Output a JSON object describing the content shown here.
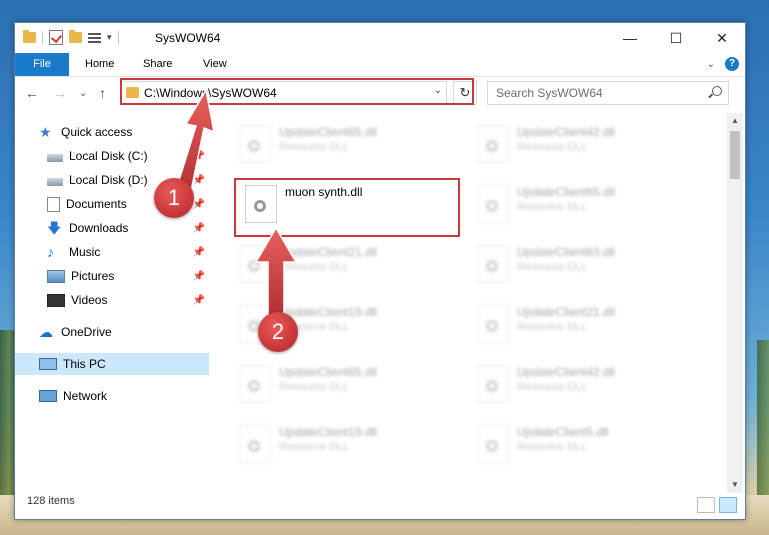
{
  "window": {
    "title": "SysWOW64"
  },
  "ribbon": {
    "tabs": [
      "File",
      "Home",
      "Share",
      "View"
    ]
  },
  "address": {
    "path": "C:\\Windows\\SysWOW64"
  },
  "search": {
    "placeholder": "Search SysWOW64"
  },
  "sidebar": {
    "items": [
      {
        "label": "Quick access",
        "icon": "star-icon"
      },
      {
        "label": "Local Disk (C:)",
        "icon": "disk-icon",
        "pinned": true
      },
      {
        "label": "Local Disk (D:)",
        "icon": "disk-icon",
        "pinned": true
      },
      {
        "label": "Documents",
        "icon": "documents-icon",
        "pinned": true
      },
      {
        "label": "Downloads",
        "icon": "downloads-icon",
        "pinned": true
      },
      {
        "label": "Music",
        "icon": "music-icon",
        "pinned": true
      },
      {
        "label": "Pictures",
        "icon": "pictures-icon",
        "pinned": true
      },
      {
        "label": "Videos",
        "icon": "videos-icon",
        "pinned": true
      },
      {
        "label": "OneDrive",
        "icon": "cloud-icon"
      },
      {
        "label": "This PC",
        "icon": "pc-icon",
        "selected": true
      },
      {
        "label": "Network",
        "icon": "network-icon"
      }
    ]
  },
  "files": {
    "highlighted": {
      "name": "muon synth.dll"
    },
    "left": [
      {
        "name": "UpdateClient65.dll",
        "type": "Resource DLL"
      },
      {
        "name": "UpdateClient21.dll",
        "type": "Resource DLL"
      },
      {
        "name": "UpdateClient19.dll",
        "type": "Resource DLL"
      },
      {
        "name": "UpdateClient65.dll",
        "type": "Resource DLL"
      },
      {
        "name": "UpdateClient19.dll",
        "type": "Resource DLL"
      }
    ],
    "right": [
      {
        "name": "UpdateClient42.dll",
        "type": "Resource DLL"
      },
      {
        "name": "UpdateClient65.dll",
        "type": "Resource DLL"
      },
      {
        "name": "UpdateClient63.dll",
        "type": "Resource DLL"
      },
      {
        "name": "UpdateClient21.dll",
        "type": "Resource DLL"
      },
      {
        "name": "UpdateClient42.dll",
        "type": "Resource DLL"
      },
      {
        "name": "UpdateClient5.dll",
        "type": "Resource DLL"
      }
    ]
  },
  "status": {
    "count": "128 items"
  },
  "annotations": {
    "badge1": "1",
    "badge2": "2",
    "color": "#c9393c"
  }
}
